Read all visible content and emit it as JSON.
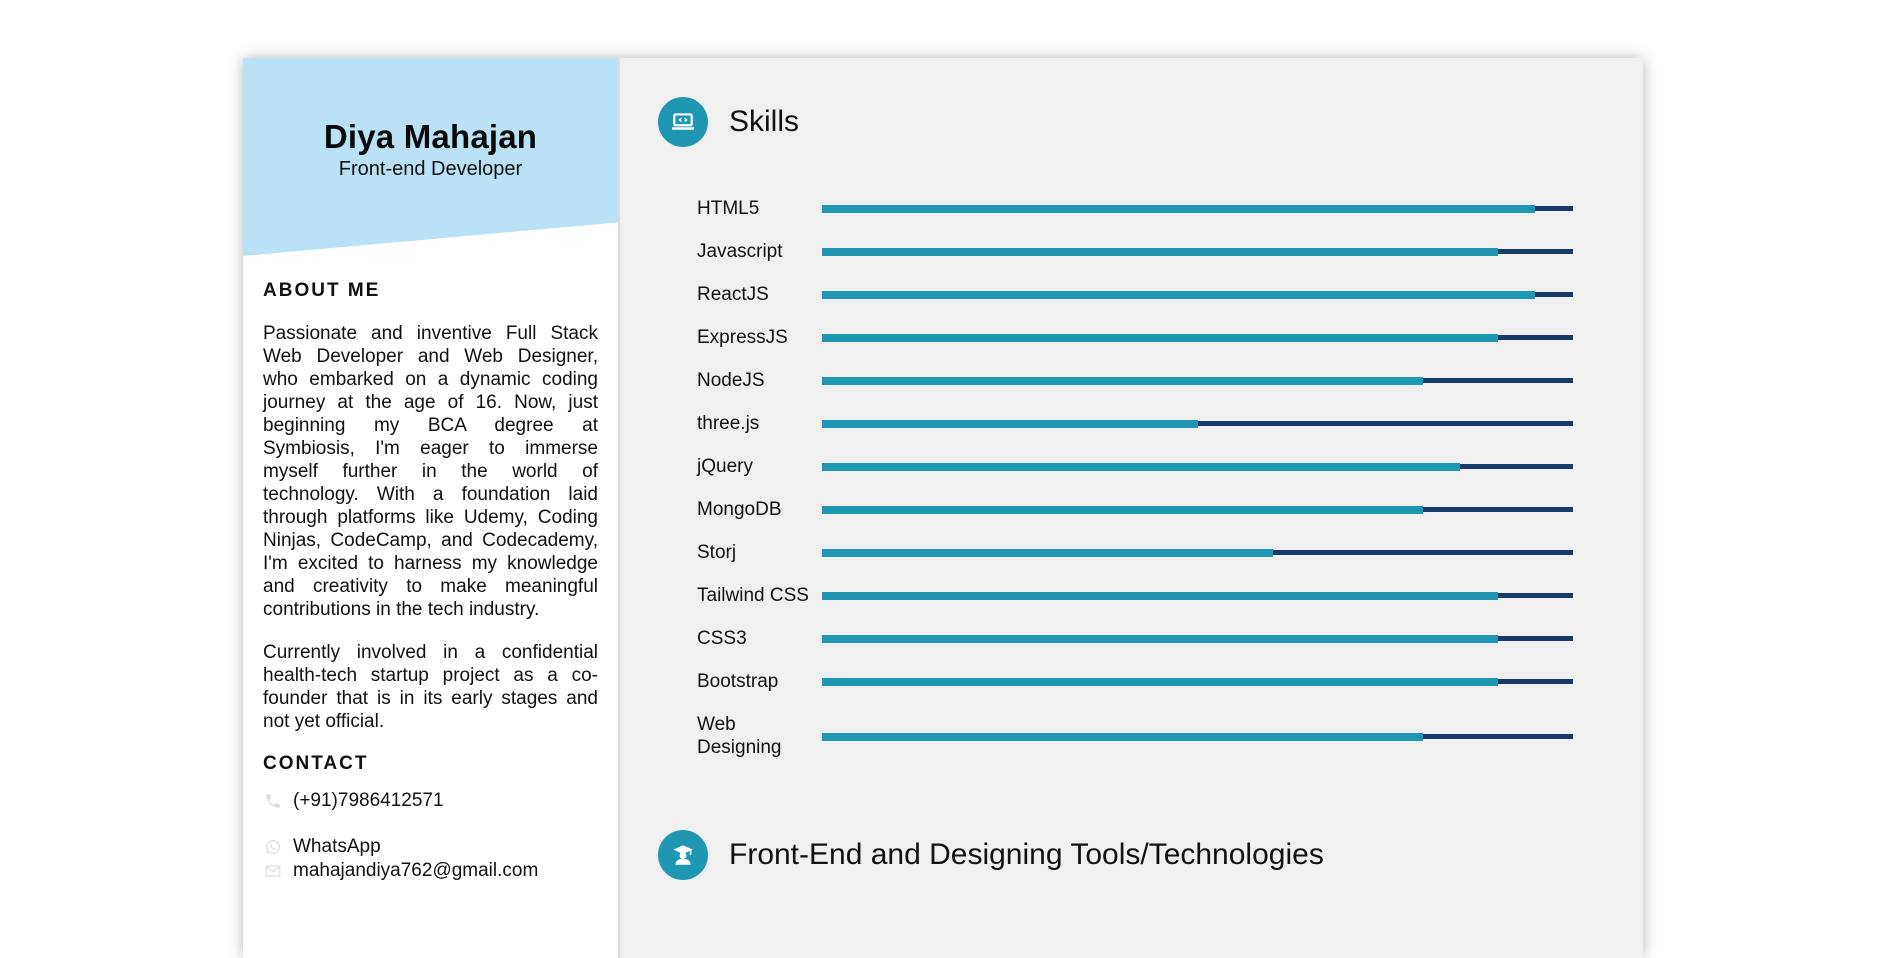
{
  "profile": {
    "name": "Diya Mahajan",
    "role": "Front-end Developer"
  },
  "about": {
    "heading": "ABOUT ME",
    "paragraph1": "Passionate and inventive Full Stack Web Developer and Web Designer, who embarked on a dynamic coding journey at the age of 16. Now, just beginning my BCA degree at Symbiosis, I'm eager to immerse myself further in the world of technology. With a foundation laid through platforms like Udemy, Coding Ninjas, CodeCamp, and Codecademy, I'm excited to harness my knowledge and creativity to make meaningful contributions in the tech industry.",
    "paragraph2": "Currently involved in a confidential health-tech startup project as a co-founder that is in its early stages and not yet official."
  },
  "contact": {
    "heading": "CONTACT",
    "phone": "(+91)7986412571",
    "whatsapp": "WhatsApp",
    "email": "mahajandiya762@gmail.com",
    "icons": [
      "phone-icon",
      "whatsapp-icon",
      "mail-icon"
    ]
  },
  "skills": {
    "title": "Skills",
    "icon": "laptop-code-icon",
    "items": [
      {
        "name": "HTML5",
        "level": 0.95
      },
      {
        "name": "Javascript",
        "level": 0.9
      },
      {
        "name": "ReactJS",
        "level": 0.95
      },
      {
        "name": "ExpressJS",
        "level": 0.9
      },
      {
        "name": "NodeJS",
        "level": 0.8
      },
      {
        "name": "three.js",
        "level": 0.5
      },
      {
        "name": "jQuery",
        "level": 0.85
      },
      {
        "name": "MongoDB",
        "level": 0.8
      },
      {
        "name": "Storj",
        "level": 0.6
      },
      {
        "name": "Tailwind CSS",
        "level": 0.9
      },
      {
        "name": "CSS3",
        "level": 0.9
      },
      {
        "name": "Bootstrap",
        "level": 0.9
      },
      {
        "name": "Web Designing",
        "level": 0.8
      }
    ]
  },
  "tools": {
    "title": "Front-End and Designing Tools/Technologies",
    "icon": "graduate-icon"
  },
  "colors": {
    "accent": "#1f96b2",
    "bar_track": "#173a6a",
    "profile_bg": "#b9e2f7"
  }
}
